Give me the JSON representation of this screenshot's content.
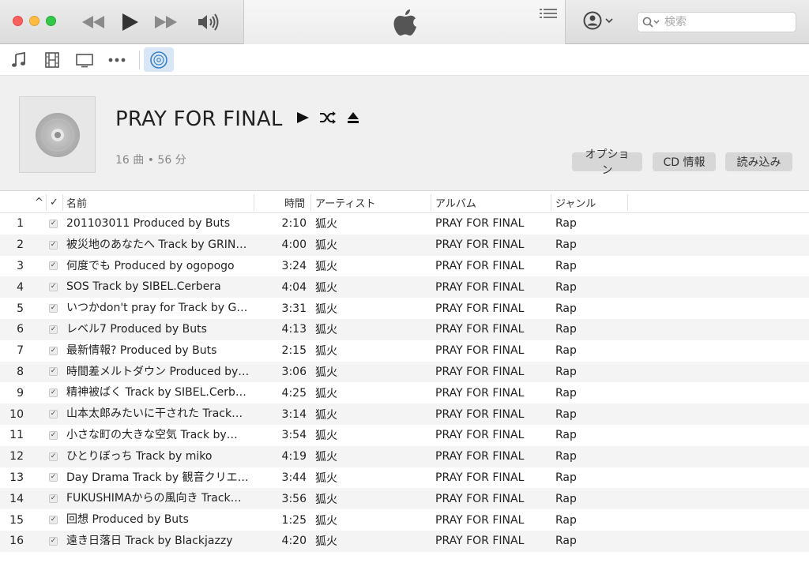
{
  "window": {
    "apple_logo": "apple-logo"
  },
  "search": {
    "placeholder": "検索"
  },
  "header": {
    "album_title": "PRAY FOR FINAL",
    "meta": "16 曲 • 56 分",
    "buttons": {
      "options": "オプション",
      "cd_info": "CD 情報",
      "import": "読み込み"
    }
  },
  "columns": {
    "sort": "^",
    "check": "✓",
    "name": "名前",
    "time": "時間",
    "artist": "アーティスト",
    "album": "アルバム",
    "genre": "ジャンル"
  },
  "tracks": [
    {
      "num": "1",
      "name": "201103011 Produced by Buts",
      "time": "2:10",
      "artist": "狐火",
      "album": "PRAY FOR FINAL",
      "genre": "Rap"
    },
    {
      "num": "2",
      "name": "被災地のあなたへ Track by GRIN…",
      "time": "4:00",
      "artist": "狐火",
      "album": "PRAY FOR FINAL",
      "genre": "Rap"
    },
    {
      "num": "3",
      "name": "何度でも Produced by ogopogo",
      "time": "3:24",
      "artist": "狐火",
      "album": "PRAY FOR FINAL",
      "genre": "Rap"
    },
    {
      "num": "4",
      "name": "SOS Track by SIBEL.Cerbera",
      "time": "4:04",
      "artist": "狐火",
      "album": "PRAY FOR FINAL",
      "genre": "Rap"
    },
    {
      "num": "5",
      "name": "いつかdon't pray for Track by G…",
      "time": "3:31",
      "artist": "狐火",
      "album": "PRAY FOR FINAL",
      "genre": "Rap"
    },
    {
      "num": "6",
      "name": "レベル7 Produced by Buts",
      "time": "4:13",
      "artist": "狐火",
      "album": "PRAY FOR FINAL",
      "genre": "Rap"
    },
    {
      "num": "7",
      "name": "最新情報? Produced by Buts",
      "time": "2:15",
      "artist": "狐火",
      "album": "PRAY FOR FINAL",
      "genre": "Rap"
    },
    {
      "num": "8",
      "name": "時間差メルトダウン Produced by…",
      "time": "3:06",
      "artist": "狐火",
      "album": "PRAY FOR FINAL",
      "genre": "Rap"
    },
    {
      "num": "9",
      "name": "精神被ばく Track by SIBEL.Cerb…",
      "time": "4:25",
      "artist": "狐火",
      "album": "PRAY FOR FINAL",
      "genre": "Rap"
    },
    {
      "num": "10",
      "name": "山本太郎みたいに干された Track…",
      "time": "3:14",
      "artist": "狐火",
      "album": "PRAY FOR FINAL",
      "genre": "Rap"
    },
    {
      "num": "11",
      "name": "小さな町の大きな空気 Track by…",
      "time": "3:54",
      "artist": "狐火",
      "album": "PRAY FOR FINAL",
      "genre": "Rap"
    },
    {
      "num": "12",
      "name": "ひとりぼっち Track by miko",
      "time": "4:19",
      "artist": "狐火",
      "album": "PRAY FOR FINAL",
      "genre": "Rap"
    },
    {
      "num": "13",
      "name": "Day Drama Track by 観音クリエ…",
      "time": "3:44",
      "artist": "狐火",
      "album": "PRAY FOR FINAL",
      "genre": "Rap"
    },
    {
      "num": "14",
      "name": "FUKUSHIMAからの風向き Track…",
      "time": "3:56",
      "artist": "狐火",
      "album": "PRAY FOR FINAL",
      "genre": "Rap"
    },
    {
      "num": "15",
      "name": "回想 Produced by Buts",
      "time": "1:25",
      "artist": "狐火",
      "album": "PRAY FOR FINAL",
      "genre": "Rap"
    },
    {
      "num": "16",
      "name": "遠き日落日 Track by Blackjazzy",
      "time": "4:20",
      "artist": "狐火",
      "album": "PRAY FOR FINAL",
      "genre": "Rap"
    }
  ]
}
